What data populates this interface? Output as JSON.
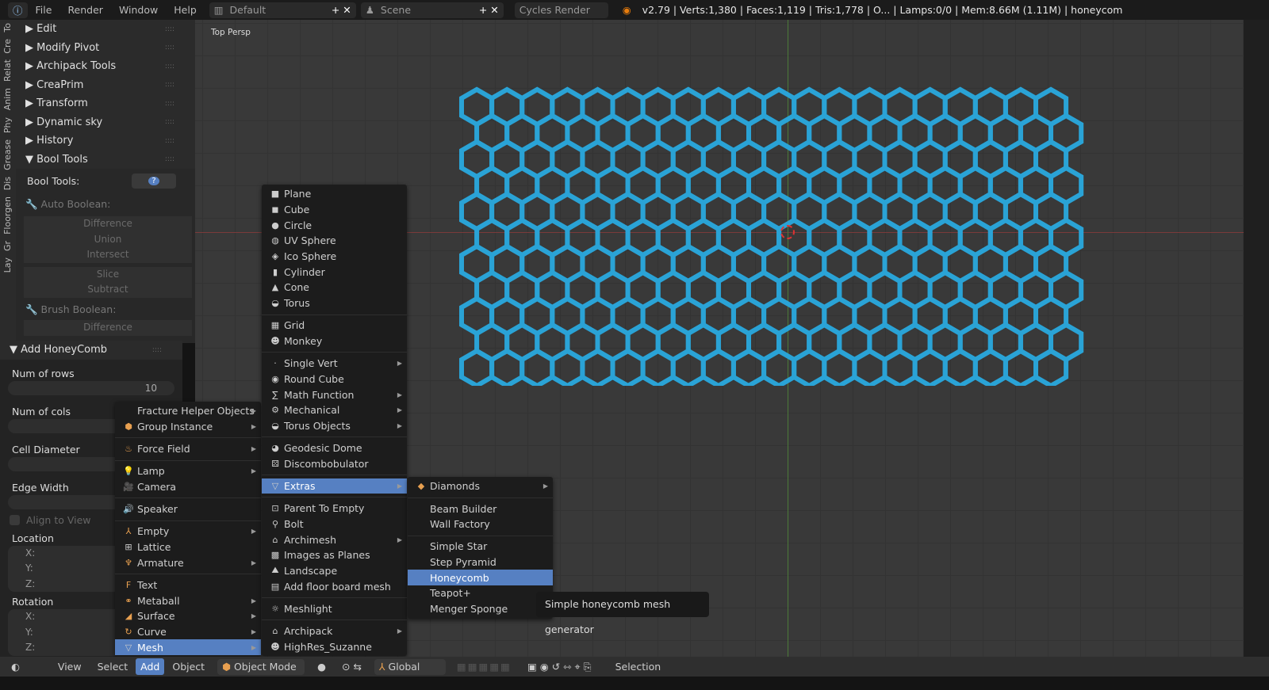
{
  "topbar": {
    "menus": [
      "File",
      "Render",
      "Window",
      "Help"
    ],
    "screen": "Default",
    "scene": "Scene",
    "engine": "Cycles Render",
    "stats": "v2.79 | Verts:1,380 | Faces:1,119 | Tris:1,778 | O... | Lamps:0/0 | Mem:8.66M (1.11M) | honeycom"
  },
  "tabs": [
    "To",
    "Cre",
    "Relat",
    "Anim",
    "Phy",
    "Grease",
    "Dis",
    "Floorgen",
    "Gr",
    "Lay"
  ],
  "panel": {
    "headers": [
      "Edit",
      "Modify Pivot",
      "Archipack Tools",
      "CreaPrim",
      "Transform",
      "Dynamic sky",
      "History",
      "Bool Tools"
    ],
    "bool_tools_label": "Bool Tools:",
    "help": "?",
    "auto_boolean": "Auto Boolean:",
    "auto_ops": [
      "Difference",
      "Union",
      "Intersect",
      "Slice",
      "Subtract"
    ],
    "brush_boolean": "Brush Boolean:",
    "brush_ops": [
      "Difference"
    ]
  },
  "operator": {
    "title": "Add HoneyComb",
    "rows_label": "Num of rows",
    "rows_value": "10",
    "cols_label": "Num of cols",
    "diameter_label": "Cell Diameter",
    "edge_label": "Edge Width",
    "align_label": "Align to View",
    "location_label": "Location",
    "rotation_label": "Rotation",
    "axes": [
      "X:",
      "Y:",
      "Z:"
    ]
  },
  "viewport": {
    "label": "Top Persp",
    "honeycomb_rows": 10,
    "honeycomb_cols": 20,
    "mesh_color": "#2aa3d6"
  },
  "add_menu": [
    {
      "label": "Fracture Helper Objects",
      "icon": "",
      "sub": true
    },
    {
      "label": "Group Instance",
      "icon": "group",
      "sub": true
    },
    {
      "sep": true
    },
    {
      "label": "Force Field",
      "icon": "force",
      "sub": true
    },
    {
      "sep": true
    },
    {
      "label": "Lamp",
      "icon": "lamp",
      "sub": true
    },
    {
      "label": "Camera",
      "icon": "camera"
    },
    {
      "sep": true
    },
    {
      "label": "Speaker",
      "icon": "speaker"
    },
    {
      "sep": true
    },
    {
      "label": "Empty",
      "icon": "empty",
      "sub": true
    },
    {
      "label": "Lattice",
      "icon": "lattice"
    },
    {
      "label": "Armature",
      "icon": "armature",
      "sub": true
    },
    {
      "sep": true
    },
    {
      "label": "Text",
      "icon": "text"
    },
    {
      "label": "Metaball",
      "icon": "metaball",
      "sub": true
    },
    {
      "label": "Surface",
      "icon": "surface",
      "sub": true
    },
    {
      "label": "Curve",
      "icon": "curve",
      "sub": true
    },
    {
      "label": "Mesh",
      "icon": "mesh",
      "sub": true,
      "hl": true
    }
  ],
  "mesh_menu": [
    {
      "label": "Plane",
      "icon": "plane"
    },
    {
      "label": "Cube",
      "icon": "cube"
    },
    {
      "label": "Circle",
      "icon": "circle"
    },
    {
      "label": "UV Sphere",
      "icon": "sphere"
    },
    {
      "label": "Ico Sphere",
      "icon": "ico"
    },
    {
      "label": "Cylinder",
      "icon": "cylinder"
    },
    {
      "label": "Cone",
      "icon": "cone"
    },
    {
      "label": "Torus",
      "icon": "torus"
    },
    {
      "sep": true
    },
    {
      "label": "Grid",
      "icon": "grid"
    },
    {
      "label": "Monkey",
      "icon": "monkey"
    },
    {
      "sep": true
    },
    {
      "label": "Single Vert",
      "icon": "vert",
      "sub": true
    },
    {
      "label": "Round Cube",
      "icon": "round"
    },
    {
      "label": "Math Function",
      "icon": "math",
      "sub": true
    },
    {
      "label": "Mechanical",
      "icon": "gear",
      "sub": true
    },
    {
      "label": "Torus Objects",
      "icon": "torus",
      "sub": true
    },
    {
      "sep": true
    },
    {
      "label": "Geodesic Dome",
      "icon": "dome"
    },
    {
      "label": "Discombobulator",
      "icon": "disc"
    },
    {
      "sep": true
    },
    {
      "label": "Extras",
      "icon": "mesh",
      "sub": true,
      "hl": true
    },
    {
      "sep": true
    },
    {
      "label": "Parent To Empty",
      "icon": "parent"
    },
    {
      "label": "Bolt",
      "icon": "bolt"
    },
    {
      "label": "Archimesh",
      "icon": "archi",
      "sub": true
    },
    {
      "label": "Images as Planes",
      "icon": "image"
    },
    {
      "label": "Landscape",
      "icon": "landscape"
    },
    {
      "label": "Add floor board mesh",
      "icon": "floor"
    },
    {
      "sep": true
    },
    {
      "label": "Meshlight",
      "icon": "light"
    },
    {
      "sep": true
    },
    {
      "label": "Archipack",
      "icon": "archi",
      "sub": true
    },
    {
      "label": "HighRes_Suzanne",
      "icon": "monkey"
    }
  ],
  "extras_menu": [
    {
      "label": "Diamonds",
      "icon": "diamond",
      "sub": true
    },
    {
      "sep": true
    },
    {
      "label": "Beam Builder",
      "icon": ""
    },
    {
      "label": "Wall Factory",
      "icon": ""
    },
    {
      "sep": true
    },
    {
      "label": "Simple Star",
      "icon": ""
    },
    {
      "label": "Step Pyramid",
      "icon": ""
    },
    {
      "label": "Honeycomb",
      "icon": "",
      "hl": true
    },
    {
      "label": "Teapot+",
      "icon": ""
    },
    {
      "label": "Menger Sponge",
      "icon": ""
    }
  ],
  "tooltip": "Simple honeycomb mesh generator",
  "bottombar": {
    "items": [
      "View",
      "Select",
      "Add",
      "Object"
    ],
    "mode": "Object Mode",
    "orientation": "Global",
    "status": "Selection"
  }
}
